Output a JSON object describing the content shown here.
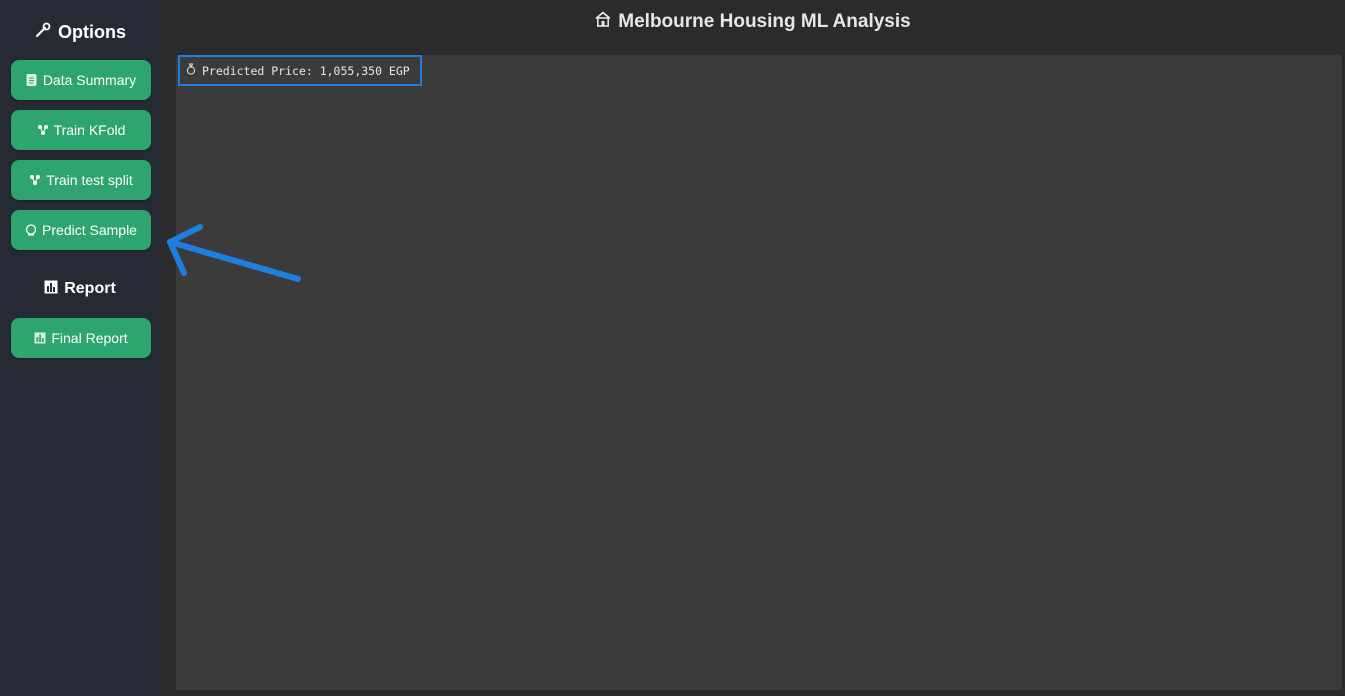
{
  "header": {
    "title": "Melbourne Housing ML Analysis",
    "title_icon": "house-icon"
  },
  "sidebar": {
    "options_heading": "Options",
    "options_icon": "wrench-icon",
    "buttons": [
      {
        "label": "Data Summary",
        "icon": "document-icon"
      },
      {
        "label": "Train KFold",
        "icon": "model-icon"
      },
      {
        "label": "Train test split",
        "icon": "model-icon"
      },
      {
        "label": "Predict Sample",
        "icon": "crystal-ball-icon"
      }
    ],
    "report_heading": "Report",
    "report_icon": "chart-icon",
    "report_button": {
      "label": "Final Report",
      "icon": "chart-icon"
    }
  },
  "main": {
    "result_text": "Predicted Price: 1,055,350 EGP",
    "result_icon": "money-bag-icon"
  },
  "colors": {
    "sidebar_bg": "#262a35",
    "button_green": "#2ea56e",
    "content_bg": "#3b3b3b",
    "highlight_blue": "#1f7fe0"
  }
}
